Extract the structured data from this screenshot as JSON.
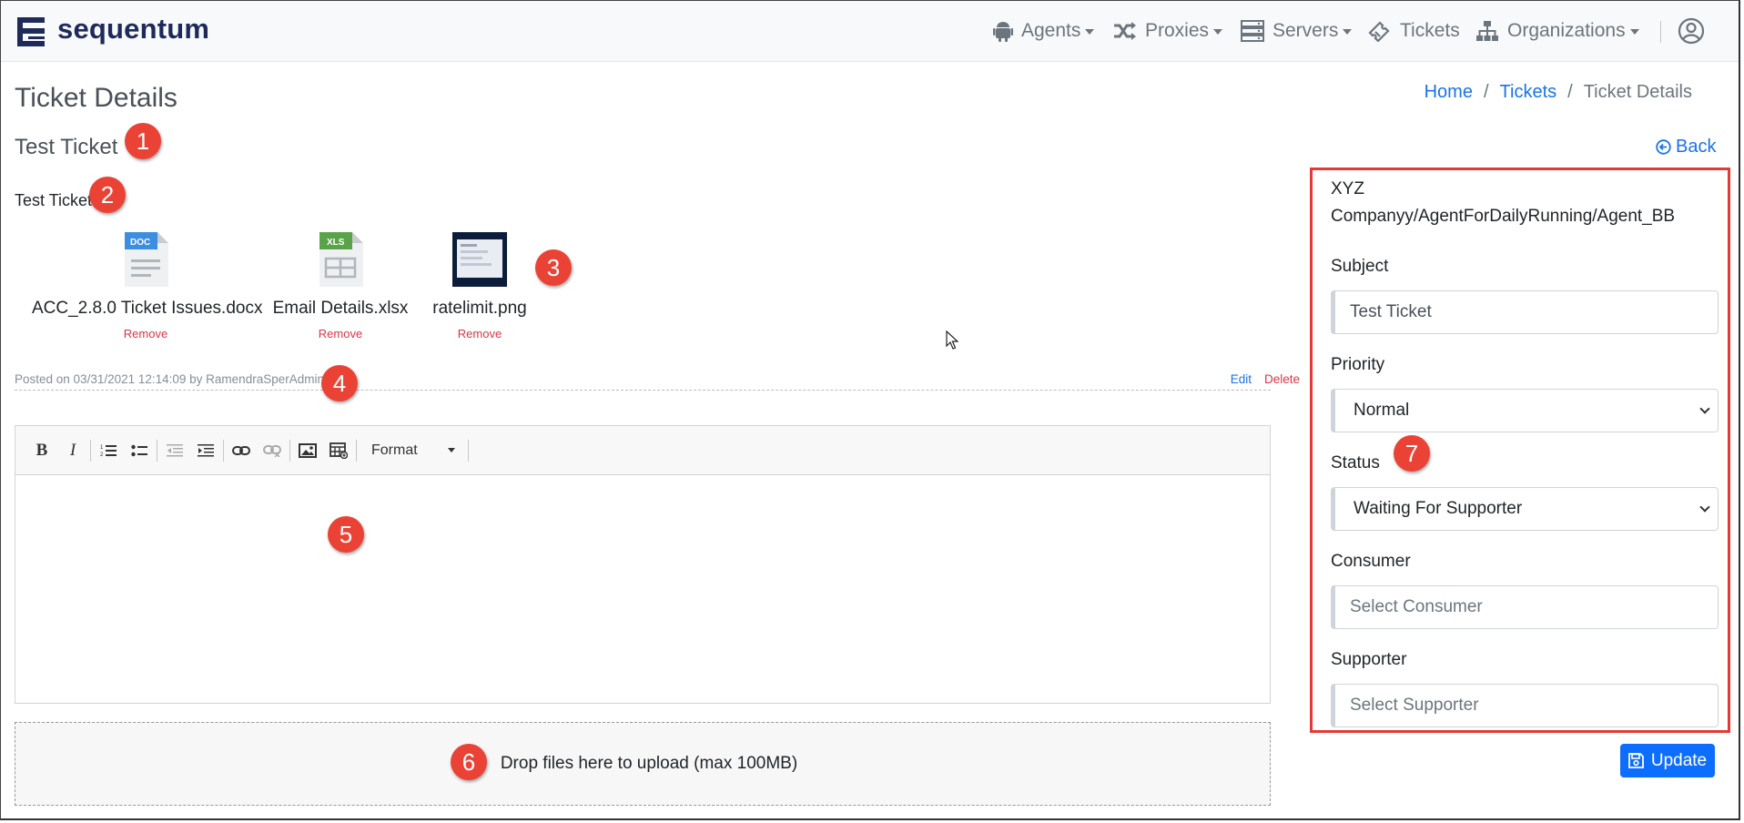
{
  "brand": {
    "name": "sequentum",
    "color": "#1e2a5a"
  },
  "nav": {
    "items": [
      {
        "label": "Agents",
        "icon": "android-icon",
        "dropdown": true
      },
      {
        "label": "Proxies",
        "icon": "shuffle-icon",
        "dropdown": true
      },
      {
        "label": "Servers",
        "icon": "server-icon",
        "dropdown": true
      },
      {
        "label": "Tickets",
        "icon": "ticket-icon",
        "dropdown": false
      },
      {
        "label": "Organizations",
        "icon": "sitemap-icon",
        "dropdown": true
      }
    ],
    "user_icon": "user-circle-icon"
  },
  "page": {
    "title": "Ticket Details",
    "breadcrumb": [
      {
        "label": "Home",
        "link": true
      },
      {
        "label": "Tickets",
        "link": true
      },
      {
        "label": "Ticket Details",
        "link": false
      }
    ],
    "back_label": "Back"
  },
  "ticket": {
    "subject": "Test Ticket",
    "body": "Test Ticket",
    "attachments": [
      {
        "name": "ACC_2.8.0 Ticket Issues.docx",
        "type": "DOC",
        "remove_label": "Remove"
      },
      {
        "name": "Email Details.xlsx",
        "type": "XLS",
        "remove_label": "Remove"
      },
      {
        "name": "ratelimit.png",
        "type": "image",
        "remove_label": "Remove"
      }
    ],
    "posted": "Posted on 03/31/2021 12:14:09 by RamendraSperAdmin",
    "edit_label": "Edit",
    "delete_label": "Delete"
  },
  "editor": {
    "toolbar": [
      "bold",
      "italic",
      "numbered-list",
      "bulleted-list",
      "outdent",
      "indent",
      "link",
      "unlink",
      "image",
      "table"
    ],
    "format_label": "Format"
  },
  "dropzone": {
    "label": "Drop files here to upload (max 100MB)"
  },
  "side": {
    "path": "XYZ Companyy/AgentForDailyRunning/Agent_BB",
    "subject_label": "Subject",
    "subject_value": "Test Ticket",
    "priority_label": "Priority",
    "priority_value": "Normal",
    "status_label": "Status",
    "status_value": "Waiting For Supporter",
    "consumer_label": "Consumer",
    "consumer_placeholder": "Select Consumer",
    "supporter_label": "Supporter",
    "supporter_placeholder": "Select Supporter",
    "update_label": "Update"
  },
  "annotations": [
    "1",
    "2",
    "3",
    "4",
    "5",
    "6",
    "7"
  ],
  "colors": {
    "accent": "#0d6efd",
    "link": "#1a73e8",
    "danger": "#dc3545",
    "badge": "#ea4335",
    "highlight_border": "#e53935"
  }
}
